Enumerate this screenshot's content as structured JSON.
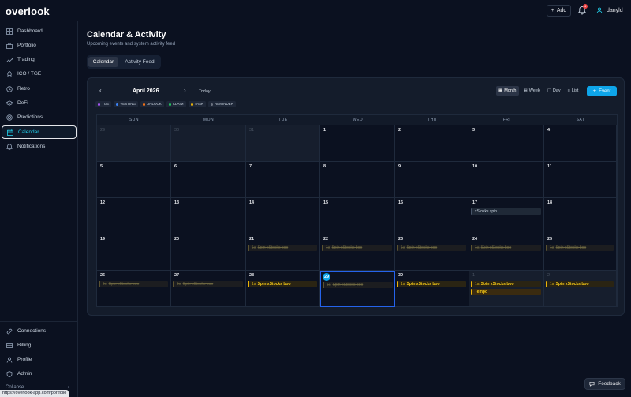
{
  "app": {
    "logo": "overlook"
  },
  "topbar": {
    "add_label": "Add",
    "notification_count": "4",
    "username": "danyld"
  },
  "sidebar": {
    "items": [
      {
        "label": "Dashboard",
        "icon": "grid-icon"
      },
      {
        "label": "Portfolio",
        "icon": "briefcase-icon"
      },
      {
        "label": "Trading",
        "icon": "trending-up-icon"
      },
      {
        "label": "ICO / TGE",
        "icon": "rocket-icon"
      },
      {
        "label": "Retro",
        "icon": "history-icon"
      },
      {
        "label": "DeFi",
        "icon": "layers-icon"
      },
      {
        "label": "Predictions",
        "icon": "target-icon"
      },
      {
        "label": "Calendar",
        "icon": "calendar-icon",
        "active": true
      },
      {
        "label": "Notifications",
        "icon": "bell-icon"
      }
    ],
    "bottom_items": [
      {
        "label": "Connections",
        "icon": "link-icon"
      },
      {
        "label": "Billing",
        "icon": "credit-card-icon"
      },
      {
        "label": "Profile",
        "icon": "user-icon"
      },
      {
        "label": "Admin",
        "icon": "shield-icon"
      }
    ],
    "collapse_label": "Collapse"
  },
  "status_url": "https://overlook-app.com/portfolio",
  "page": {
    "title": "Calendar & Activity",
    "subtitle": "Upcoming events and system activity feed"
  },
  "tabs": [
    {
      "label": "Calendar",
      "active": true
    },
    {
      "label": "Activity Feed",
      "active": false
    }
  ],
  "calendar": {
    "month_label": "April 2026",
    "today_label": "Today",
    "views": [
      {
        "label": "Month",
        "active": true
      },
      {
        "label": "Week",
        "active": false
      },
      {
        "label": "Day",
        "active": false
      },
      {
        "label": "List",
        "active": false
      }
    ],
    "event_button_label": "Event",
    "legend": [
      {
        "label": "TGE",
        "color": "#a855f7"
      },
      {
        "label": "VESTING",
        "color": "#3b82f6"
      },
      {
        "label": "UNLOCK",
        "color": "#f97316"
      },
      {
        "label": "CLAIM",
        "color": "#22c55e"
      },
      {
        "label": "TASK",
        "color": "#eab308"
      },
      {
        "label": "REMINDER",
        "color": "#6b7280"
      }
    ],
    "weekdays": [
      "SUN",
      "MON",
      "TUE",
      "WED",
      "THU",
      "FRI",
      "SAT"
    ],
    "weeks": [
      [
        {
          "d": "29",
          "off": true
        },
        {
          "d": "30",
          "off": true
        },
        {
          "d": "31",
          "off": true
        },
        {
          "d": "1"
        },
        {
          "d": "2"
        },
        {
          "d": "3"
        },
        {
          "d": "4"
        }
      ],
      [
        {
          "d": "5"
        },
        {
          "d": "6"
        },
        {
          "d": "7"
        },
        {
          "d": "8"
        },
        {
          "d": "9"
        },
        {
          "d": "10"
        },
        {
          "d": "11"
        }
      ],
      [
        {
          "d": "12"
        },
        {
          "d": "13"
        },
        {
          "d": "14"
        },
        {
          "d": "15"
        },
        {
          "d": "16"
        },
        {
          "d": "17",
          "events": [
            {
              "text": "xStocks spin",
              "kind": "plain"
            }
          ]
        },
        {
          "d": "18"
        }
      ],
      [
        {
          "d": "19"
        },
        {
          "d": "20"
        },
        {
          "d": "21",
          "events": [
            {
              "time": "1a",
              "text": "Spin xStocks boo",
              "kind": "spin past"
            }
          ]
        },
        {
          "d": "22",
          "events": [
            {
              "time": "1a",
              "text": "Spin xStocks boo",
              "kind": "spin past"
            }
          ]
        },
        {
          "d": "23",
          "events": [
            {
              "time": "1a",
              "text": "Spin xStocks boo",
              "kind": "spin past"
            }
          ]
        },
        {
          "d": "24",
          "events": [
            {
              "time": "1a",
              "text": "Spin xStocks boo",
              "kind": "spin past"
            }
          ]
        },
        {
          "d": "25",
          "events": [
            {
              "time": "1a",
              "text": "Spin xStocks boo",
              "kind": "spin past"
            }
          ]
        }
      ],
      [
        {
          "d": "26",
          "events": [
            {
              "time": "1a",
              "text": "Spin xStocks boo",
              "kind": "spin past"
            }
          ]
        },
        {
          "d": "27",
          "events": [
            {
              "time": "1a",
              "text": "Spin xStocks boo",
              "kind": "spin past"
            }
          ]
        },
        {
          "d": "28",
          "events": [
            {
              "time": "1a",
              "text": "Spin xStocks boo",
              "kind": "spin"
            }
          ]
        },
        {
          "d": "29",
          "today": true,
          "events": [
            {
              "time": "1a",
              "text": "Spin xStocks boo",
              "kind": "spin past"
            }
          ]
        },
        {
          "d": "30",
          "events": [
            {
              "time": "1a",
              "text": "Spin xStocks boo",
              "kind": "spin"
            }
          ]
        },
        {
          "d": "1",
          "off": true,
          "events": [
            {
              "time": "1a",
              "text": "Spin xStocks boo",
              "kind": "spin"
            },
            {
              "text": "Tempo",
              "kind": "tempo"
            }
          ]
        },
        {
          "d": "2",
          "off": true,
          "events": [
            {
              "time": "1a",
              "text": "Spin xStocks boo",
              "kind": "spin"
            }
          ]
        }
      ]
    ]
  },
  "feedback_label": "Feedback"
}
